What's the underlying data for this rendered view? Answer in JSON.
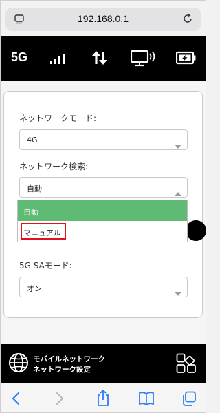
{
  "browser": {
    "url": "192.168.0.1",
    "tabs_icon": "tabs-icon",
    "reload_icon": "reload-icon"
  },
  "status_bar": {
    "network_type": "5G",
    "icons": [
      "signal-bars-icon",
      "data-transfer-arrows-icon",
      "monitor-wifi-icon",
      "battery-charging-icon"
    ]
  },
  "form": {
    "network_mode": {
      "label": "ネットワークモード:",
      "value": "4G"
    },
    "network_search": {
      "label": "ネットワーク検索:",
      "value": "自動",
      "options": [
        "自動",
        "マニュアル"
      ],
      "selected_option": "自動"
    },
    "sa_mode": {
      "label": "5G SAモード:",
      "value": "オン"
    }
  },
  "footer": {
    "line1": "モバイルネットワーク",
    "line2": "ネットワーク設定"
  },
  "colors": {
    "selected_option": "#5fbb74",
    "highlight_box": "#e2101b",
    "ios_blue": "#2f7cf6"
  }
}
